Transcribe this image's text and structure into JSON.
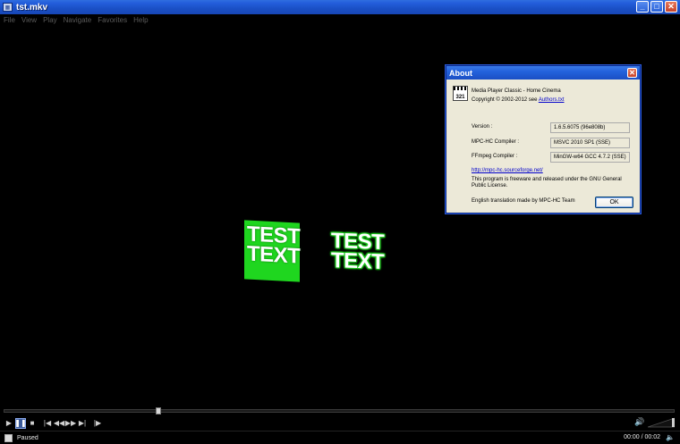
{
  "window": {
    "title": "tst.mkv",
    "minimize": "_",
    "maximize": "□",
    "close": "✕"
  },
  "menu": [
    "File",
    "View",
    "Play",
    "Navigate",
    "Favorites",
    "Help"
  ],
  "video": {
    "subtitle_green": [
      "TEST",
      "TEXT"
    ],
    "subtitle_outline": [
      "TEST",
      "TEXT"
    ]
  },
  "about": {
    "title": "About",
    "product": "Media Player Classic - Home Cinema",
    "copyright_prefix": "Copyright © 2002-2012 see ",
    "authors_link": "Authors.txt",
    "version_label": "Version :",
    "version_value": "1.6.5.6075 (96e808b)",
    "compiler_label": "MPC-HC Compiler :",
    "compiler_value": "MSVC 2010 SP1 (SSE)",
    "ffmpeg_label": "FFmpeg Compiler :",
    "ffmpeg_value": "MinGW-w64 GCC 4.7.2 (SSE)",
    "website_link": "http://mpc-hc.sourceforge.net/",
    "license_text": "This program is freeware and released under the GNU General Public License.",
    "translation_text": "English translation made by MPC-HC Team",
    "ok_label": "OK"
  },
  "seek": {
    "position_fraction": 0.23
  },
  "status": {
    "state": "Paused",
    "time": "00:00 / 00:02"
  },
  "icons": {
    "play": "play-icon",
    "pause": "pause-icon",
    "stop": "stop-icon",
    "prev": "skip-back-icon",
    "rewind": "rewind-icon",
    "forward": "fast-forward-icon",
    "next": "skip-forward-icon",
    "frame_step": "frame-step-icon",
    "volume": "speaker-icon"
  }
}
